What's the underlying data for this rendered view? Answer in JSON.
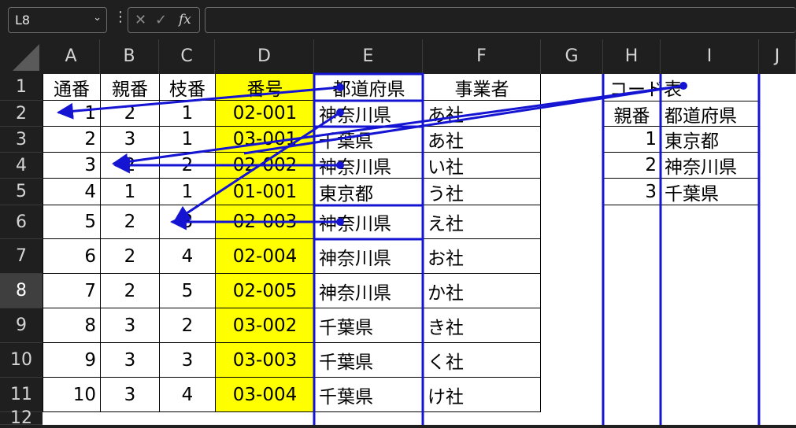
{
  "formula_bar": {
    "name_box": "L8",
    "formula": ""
  },
  "columns": [
    "A",
    "B",
    "C",
    "D",
    "E",
    "F",
    "G",
    "H",
    "I",
    "J"
  ],
  "rows": [
    "1",
    "2",
    "3",
    "4",
    "5",
    "6",
    "7",
    "8",
    "9",
    "10",
    "11",
    "12"
  ],
  "selected_row": "8",
  "table": {
    "headers": [
      "通番",
      "親番",
      "枝番",
      "番号",
      "都道府県",
      "事業者"
    ],
    "rows": [
      [
        "1",
        "2",
        "1",
        "02-001",
        "神奈川県",
        "あ社"
      ],
      [
        "2",
        "3",
        "1",
        "03-001",
        "千葉県",
        "あ社"
      ],
      [
        "3",
        "2",
        "2",
        "02-002",
        "神奈川県",
        "い社"
      ],
      [
        "4",
        "1",
        "1",
        "01-001",
        "東京都",
        "う社"
      ],
      [
        "5",
        "2",
        "3",
        "02-003",
        "神奈川県",
        "え社"
      ],
      [
        "6",
        "2",
        "4",
        "02-004",
        "神奈川県",
        "お社"
      ],
      [
        "7",
        "2",
        "5",
        "02-005",
        "神奈川県",
        "か社"
      ],
      [
        "8",
        "3",
        "2",
        "03-002",
        "千葉県",
        "き社"
      ],
      [
        "9",
        "3",
        "3",
        "03-003",
        "千葉県",
        "く社"
      ],
      [
        "10",
        "3",
        "4",
        "03-004",
        "千葉県",
        "け社"
      ]
    ]
  },
  "code_table": {
    "title": "コード表",
    "headers": [
      "親番",
      "都道府県"
    ],
    "rows": [
      [
        "1",
        "東京都"
      ],
      [
        "2",
        "神奈川県"
      ],
      [
        "3",
        "千葉県"
      ]
    ]
  },
  "colors": {
    "highlight": "#ffff00",
    "arrow": "#1414d2",
    "header_bg": "#1f1f1f"
  }
}
